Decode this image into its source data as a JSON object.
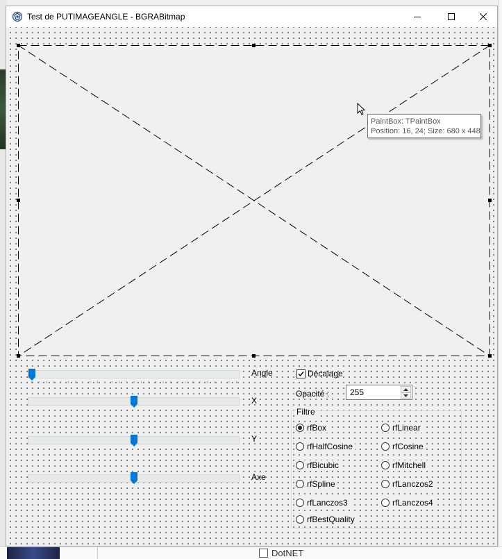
{
  "window": {
    "title": "Test de PUTIMAGEANGLE - BGRABitmap",
    "controls": {
      "minimize": "minimize-icon",
      "maximize": "maximize-icon",
      "close": "close-icon"
    }
  },
  "paintbox": {
    "tooltip_line1": "PaintBox: TPaintBox",
    "tooltip_line2": "Position: 16, 24; Size: 680 x 448"
  },
  "trackbars": [
    {
      "label": "Angle",
      "level": 0.0
    },
    {
      "label": "X",
      "level": 0.5
    },
    {
      "label": "Y",
      "level": 0.5
    },
    {
      "label": "Axe",
      "level": 0.5
    }
  ],
  "decalage": {
    "label": "Décalage",
    "checked": true
  },
  "opacite": {
    "label": "Opacité :",
    "value": "255"
  },
  "filtre": {
    "title": "Filtre",
    "options": [
      {
        "label": "rfBox",
        "checked": true
      },
      {
        "label": "rfLinear",
        "checked": false
      },
      {
        "label": "rfHalfCosine",
        "checked": false
      },
      {
        "label": "rfCosine",
        "checked": false
      },
      {
        "label": "rfBicubic",
        "checked": false
      },
      {
        "label": "rfMitchell",
        "checked": false
      },
      {
        "label": "rfSpline",
        "checked": false
      },
      {
        "label": "rfLanczos2",
        "checked": false
      },
      {
        "label": "rfLanczos3",
        "checked": false
      },
      {
        "label": "rfLanczos4",
        "checked": false
      },
      {
        "label": "rfBestQuality",
        "checked": false
      }
    ]
  },
  "background": {
    "bottom_checkbox_label": "DotNET"
  },
  "colors": {
    "accent": "#0078d7",
    "dots": "#555555"
  }
}
